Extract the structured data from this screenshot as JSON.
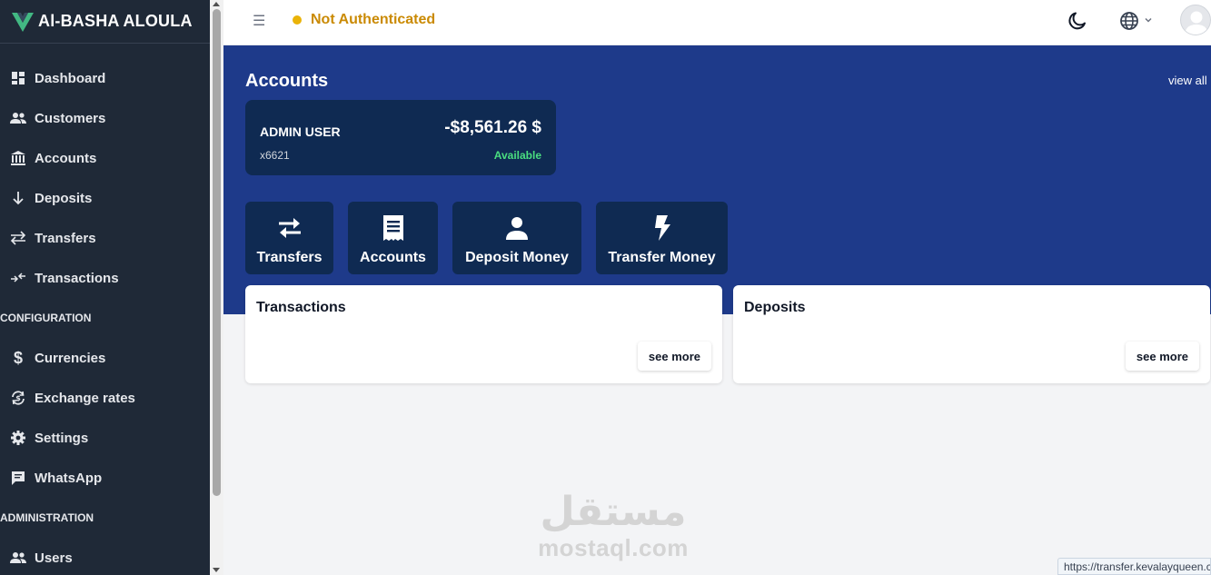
{
  "sidebar": {
    "brand": "Al-BASHA ALOULA",
    "items": [
      {
        "label": "Dashboard",
        "icon": "dashboard-icon"
      },
      {
        "label": "Customers",
        "icon": "users-icon"
      },
      {
        "label": "Accounts",
        "icon": "bank-icon"
      },
      {
        "label": "Deposits",
        "icon": "arrow-down-icon"
      },
      {
        "label": "Transfers",
        "icon": "swap-icon"
      },
      {
        "label": "Transactions",
        "icon": "transactions-icon"
      }
    ],
    "section_config": "CONFIGURATION",
    "config_items": [
      {
        "label": "Currencies",
        "icon": "dollar-icon"
      },
      {
        "label": "Exchange rates",
        "icon": "exchange-icon"
      },
      {
        "label": "Settings",
        "icon": "gear-icon"
      },
      {
        "label": "WhatsApp",
        "icon": "message-icon"
      }
    ],
    "section_admin": "ADMINISTRATION",
    "admin_items": [
      {
        "label": "Users",
        "icon": "users-icon"
      }
    ]
  },
  "topbar": {
    "menu_glyph": "☰",
    "auth_status": "Not Authenticated",
    "colors": {
      "warning": "#ca8a04",
      "warning_dot": "#eab308"
    }
  },
  "hero": {
    "title": "Accounts",
    "view_all": "view all",
    "account": {
      "name": "ADMIN USER",
      "balance": "-$8,561.26 $",
      "number": "x6621",
      "status": "Available"
    },
    "quick_actions": [
      {
        "label": "Transfers",
        "icon": "swap-icon"
      },
      {
        "label": "Accounts",
        "icon": "receipt-icon"
      },
      {
        "label": "Deposit Money",
        "icon": "user-icon"
      },
      {
        "label": "Transfer Money",
        "icon": "lightning-icon"
      }
    ],
    "colors": {
      "background": "#1e3a8a",
      "card": "#0f2a52",
      "available": "#4ade80"
    }
  },
  "panels": {
    "transactions": {
      "title": "Transactions",
      "see_more": "see more"
    },
    "deposits": {
      "title": "Deposits",
      "see_more": "see more"
    }
  },
  "watermark": {
    "arabic": "مستقل",
    "latin": "mostaql.com"
  },
  "status_bar": {
    "url": "https://transfer.kevalayqueen.c"
  }
}
